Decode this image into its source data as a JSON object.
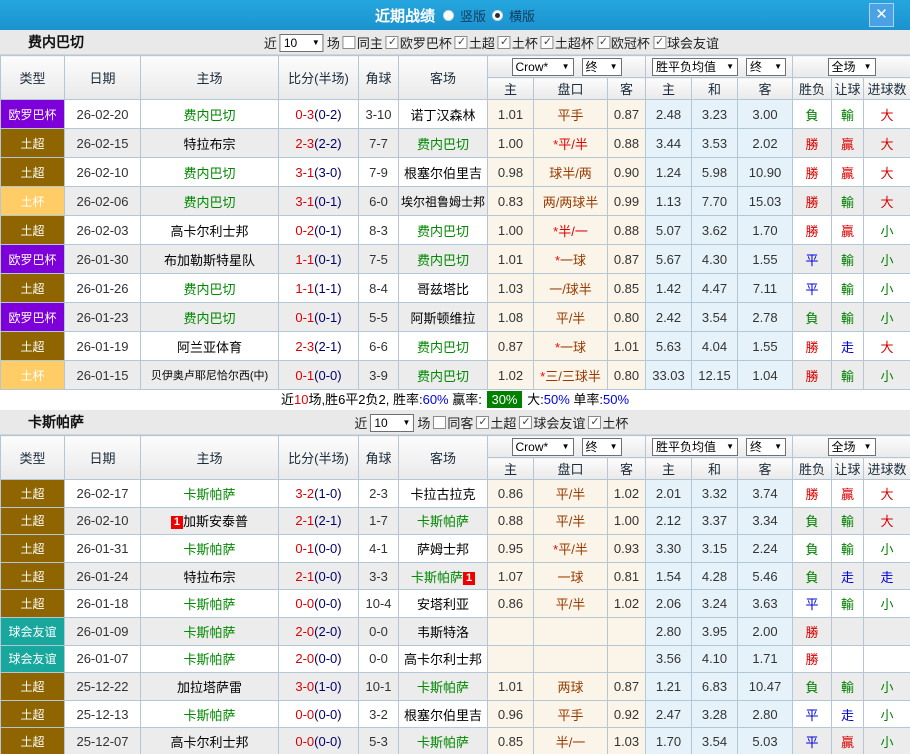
{
  "titlebar": {
    "title": "近期战绩",
    "layout_options": [
      {
        "label": "竖版",
        "selected": false
      },
      {
        "label": "横版",
        "selected": true
      }
    ],
    "close_label": "✕"
  },
  "table_header": {
    "cols": [
      "类型",
      "日期",
      "主场",
      "比分(半场)",
      "角球",
      "客场"
    ],
    "odds_group": {
      "select1": "Crow*",
      "select2": "终",
      "subcols": [
        "主",
        "盘口",
        "客"
      ]
    },
    "avg_group": {
      "select1": "胜平负均值",
      "select2": "终",
      "subcols": [
        "主",
        "和",
        "客"
      ]
    },
    "result_group": {
      "select1": "全场",
      "subcols": [
        "胜负",
        "让球",
        "进球数"
      ]
    }
  },
  "colors": {
    "type_badges": {
      "欧罗巴杯": "#7d00da",
      "土超": "#8e6500",
      "土杯": "#ffcc66",
      "欧冠杯": "#8e6500",
      "球会友谊": "#17a79d"
    },
    "outcome": {
      "勝": "#dd0000",
      "贏": "#dd0000",
      "大": "#dd0000",
      "負": "#008000",
      "輸": "#008000",
      "小": "#008000",
      "平": "#0000dd",
      "走": "#0000dd"
    }
  },
  "sections": [
    {
      "team": "费内巴切",
      "filter": {
        "near": "近",
        "count": "10",
        "unit": "场",
        "same": {
          "label": "同主",
          "checked": false
        },
        "leagues": [
          {
            "label": "欧罗巴杯",
            "checked": true
          },
          {
            "label": "土超",
            "checked": true
          },
          {
            "label": "土杯",
            "checked": true
          },
          {
            "label": "土超杯",
            "checked": true
          },
          {
            "label": "欧冠杯",
            "checked": true
          },
          {
            "label": "球会友谊",
            "checked": true
          }
        ]
      },
      "rows": [
        {
          "t": "欧罗巴杯",
          "d": "26-02-20",
          "h": "费内巴切",
          "hg": true,
          "hc": false,
          "s": "0-3",
          "sh": "(0-2)",
          "cn": "3-10",
          "a": "诺丁汉森林",
          "ag": false,
          "ac": false,
          "o1": "1.01",
          "pks": false,
          "pk": "平手",
          "pkr": false,
          "o2": "0.87",
          "v1": "2.48",
          "v2": "3.23",
          "v3": "3.00",
          "r1": "負",
          "r2": "輸",
          "r3": "大"
        },
        {
          "t": "土超",
          "d": "26-02-15",
          "h": "特拉布宗",
          "hg": false,
          "hc": false,
          "s": "2-3",
          "sh": "(2-2)",
          "cn": "7-7",
          "a": "费内巴切",
          "ag": true,
          "ac": false,
          "o1": "1.00",
          "pks": true,
          "pk": "平/半",
          "pkr": true,
          "o2": "0.88",
          "v1": "3.44",
          "v2": "3.53",
          "v3": "2.02",
          "r1": "勝",
          "r2": "贏",
          "r3": "大"
        },
        {
          "t": "土超",
          "d": "26-02-10",
          "h": "费内巴切",
          "hg": true,
          "hc": false,
          "s": "3-1",
          "sh": "(3-0)",
          "cn": "7-9",
          "a": "根塞尔伯里吉",
          "ag": false,
          "ac": false,
          "o1": "0.98",
          "pks": false,
          "pk": "球半/两",
          "pkr": false,
          "o2": "0.90",
          "v1": "1.24",
          "v2": "5.98",
          "v3": "10.90",
          "r1": "勝",
          "r2": "贏",
          "r3": "大"
        },
        {
          "t": "土杯",
          "d": "26-02-06",
          "h": "费内巴切",
          "hg": true,
          "hc": false,
          "s": "3-1",
          "sh": "(0-1)",
          "cn": "6-0",
          "a": "埃尔祖鲁姆士邦",
          "ag": false,
          "ac": false,
          "o1": "0.83",
          "pks": false,
          "pk": "两/两球半",
          "pkr": false,
          "o2": "0.99",
          "v1": "1.13",
          "v2": "7.70",
          "v3": "15.03",
          "r1": "勝",
          "r2": "輸",
          "r3": "大"
        },
        {
          "t": "土超",
          "d": "26-02-03",
          "h": "高卡尔利士邦",
          "hg": false,
          "hc": false,
          "s": "0-2",
          "sh": "(0-1)",
          "cn": "8-3",
          "a": "费内巴切",
          "ag": true,
          "ac": false,
          "o1": "1.00",
          "pks": true,
          "pk": "半/一",
          "pkr": true,
          "o2": "0.88",
          "v1": "5.07",
          "v2": "3.62",
          "v3": "1.70",
          "r1": "勝",
          "r2": "贏",
          "r3": "小"
        },
        {
          "t": "欧罗巴杯",
          "d": "26-01-30",
          "h": "布加勒斯特星队",
          "hg": false,
          "hc": false,
          "s": "1-1",
          "sh": "(0-1)",
          "cn": "7-5",
          "a": "费内巴切",
          "ag": true,
          "ac": false,
          "o1": "1.01",
          "pks": true,
          "pk": "一球",
          "pkr": false,
          "o2": "0.87",
          "v1": "5.67",
          "v2": "4.30",
          "v3": "1.55",
          "r1": "平",
          "r2": "輸",
          "r3": "小"
        },
        {
          "t": "土超",
          "d": "26-01-26",
          "h": "费内巴切",
          "hg": true,
          "hc": false,
          "s": "1-1",
          "sh": "(1-1)",
          "cn": "8-4",
          "a": "哥兹塔比",
          "ag": false,
          "ac": false,
          "o1": "1.03",
          "pks": false,
          "pk": "一/球半",
          "pkr": false,
          "o2": "0.85",
          "v1": "1.42",
          "v2": "4.47",
          "v3": "7.11",
          "r1": "平",
          "r2": "輸",
          "r3": "小"
        },
        {
          "t": "欧罗巴杯",
          "d": "26-01-23",
          "h": "费内巴切",
          "hg": true,
          "hc": false,
          "s": "0-1",
          "sh": "(0-1)",
          "cn": "5-5",
          "a": "阿斯顿维拉",
          "ag": false,
          "ac": false,
          "o1": "1.08",
          "pks": false,
          "pk": "平/半",
          "pkr": false,
          "o2": "0.80",
          "v1": "2.42",
          "v2": "3.54",
          "v3": "2.78",
          "r1": "負",
          "r2": "輸",
          "r3": "小"
        },
        {
          "t": "土超",
          "d": "26-01-19",
          "h": "阿兰亚体育",
          "hg": false,
          "hc": false,
          "s": "2-3",
          "sh": "(2-1)",
          "cn": "6-6",
          "a": "费内巴切",
          "ag": true,
          "ac": false,
          "o1": "0.87",
          "pks": true,
          "pk": "一球",
          "pkr": false,
          "o2": "1.01",
          "v1": "5.63",
          "v2": "4.04",
          "v3": "1.55",
          "r1": "勝",
          "r2": "走",
          "r3": "大"
        },
        {
          "t": "土杯",
          "d": "26-01-15",
          "h": "贝伊奥卢耶尼恰尔西(中)",
          "hg": false,
          "hc": false,
          "s": "0-1",
          "sh": "(0-0)",
          "cn": "3-9",
          "a": "费内巴切",
          "ag": true,
          "ac": false,
          "o1": "1.02",
          "pks": true,
          "pk": "三/三球半",
          "pkr": false,
          "o2": "0.80",
          "v1": "33.03",
          "v2": "12.15",
          "v3": "1.04",
          "r1": "勝",
          "r2": "輸",
          "r3": "小"
        }
      ],
      "summary": [
        {
          "t": "近",
          "c": "k"
        },
        {
          "t": "10",
          "c": "r"
        },
        {
          "t": "场,胜6平2负2, 胜率:",
          "c": "k"
        },
        {
          "t": "60%",
          "c": "b"
        },
        {
          "t": " 赢率: ",
          "c": "k"
        },
        {
          "t": "30%",
          "c": "g"
        },
        {
          "t": " 大:",
          "c": "k"
        },
        {
          "t": "50%",
          "c": "b"
        },
        {
          "t": " 单率:",
          "c": "k"
        },
        {
          "t": "50%",
          "c": "b"
        }
      ]
    },
    {
      "team": "卡斯帕萨",
      "filter": {
        "near": "近",
        "count": "10",
        "unit": "场",
        "same": {
          "label": "同客",
          "checked": false
        },
        "leagues": [
          {
            "label": "土超",
            "checked": true
          },
          {
            "label": "球会友谊",
            "checked": true
          },
          {
            "label": "土杯",
            "checked": true
          }
        ]
      },
      "rows": [
        {
          "t": "土超",
          "d": "26-02-17",
          "h": "卡斯帕萨",
          "hg": true,
          "hc": false,
          "s": "3-2",
          "sh": "(1-0)",
          "cn": "2-3",
          "a": "卡拉古拉克",
          "ag": false,
          "ac": false,
          "o1": "0.86",
          "pks": false,
          "pk": "平/半",
          "pkr": false,
          "o2": "1.02",
          "v1": "2.01",
          "v2": "3.32",
          "v3": "3.74",
          "r1": "勝",
          "r2": "贏",
          "r3": "大"
        },
        {
          "t": "土超",
          "d": "26-02-10",
          "h": "加斯安泰普",
          "hg": false,
          "hc": true,
          "s": "2-1",
          "sh": "(2-1)",
          "cn": "1-7",
          "a": "卡斯帕萨",
          "ag": true,
          "ac": false,
          "o1": "0.88",
          "pks": false,
          "pk": "平/半",
          "pkr": false,
          "o2": "1.00",
          "v1": "2.12",
          "v2": "3.37",
          "v3": "3.34",
          "r1": "負",
          "r2": "輸",
          "r3": "大"
        },
        {
          "t": "土超",
          "d": "26-01-31",
          "h": "卡斯帕萨",
          "hg": true,
          "hc": false,
          "s": "0-1",
          "sh": "(0-0)",
          "cn": "4-1",
          "a": "萨姆士邦",
          "ag": false,
          "ac": false,
          "o1": "0.95",
          "pks": true,
          "pk": "平/半",
          "pkr": false,
          "o2": "0.93",
          "v1": "3.30",
          "v2": "3.15",
          "v3": "2.24",
          "r1": "負",
          "r2": "輸",
          "r3": "小"
        },
        {
          "t": "土超",
          "d": "26-01-24",
          "h": "特拉布宗",
          "hg": false,
          "hc": false,
          "s": "2-1",
          "sh": "(0-0)",
          "cn": "3-3",
          "a": "卡斯帕萨",
          "ag": true,
          "ac": true,
          "o1": "1.07",
          "pks": false,
          "pk": "一球",
          "pkr": false,
          "o2": "0.81",
          "v1": "1.54",
          "v2": "4.28",
          "v3": "5.46",
          "r1": "負",
          "r2": "走",
          "r3": "走"
        },
        {
          "t": "土超",
          "d": "26-01-18",
          "h": "卡斯帕萨",
          "hg": true,
          "hc": false,
          "s": "0-0",
          "sh": "(0-0)",
          "cn": "10-4",
          "a": "安塔利亚",
          "ag": false,
          "ac": false,
          "o1": "0.86",
          "pks": false,
          "pk": "平/半",
          "pkr": false,
          "o2": "1.02",
          "v1": "2.06",
          "v2": "3.24",
          "v3": "3.63",
          "r1": "平",
          "r2": "輸",
          "r3": "小"
        },
        {
          "t": "球会友谊",
          "d": "26-01-09",
          "h": "卡斯帕萨",
          "hg": true,
          "hc": false,
          "s": "2-0",
          "sh": "(2-0)",
          "cn": "0-0",
          "a": "韦斯特洛",
          "ag": false,
          "ac": false,
          "o1": "",
          "pks": false,
          "pk": "",
          "pkr": false,
          "o2": "",
          "v1": "2.80",
          "v2": "3.95",
          "v3": "2.00",
          "r1": "勝",
          "r2": "",
          "r3": ""
        },
        {
          "t": "球会友谊",
          "d": "26-01-07",
          "h": "卡斯帕萨",
          "hg": true,
          "hc": false,
          "s": "2-0",
          "sh": "(0-0)",
          "cn": "0-0",
          "a": "高卡尔利士邦",
          "ag": false,
          "ac": false,
          "o1": "",
          "pks": false,
          "pk": "",
          "pkr": false,
          "o2": "",
          "v1": "3.56",
          "v2": "4.10",
          "v3": "1.71",
          "r1": "勝",
          "r2": "",
          "r3": ""
        },
        {
          "t": "土超",
          "d": "25-12-22",
          "h": "加拉塔萨雷",
          "hg": false,
          "hc": false,
          "s": "3-0",
          "sh": "(1-0)",
          "cn": "10-1",
          "a": "卡斯帕萨",
          "ag": true,
          "ac": false,
          "o1": "1.01",
          "pks": false,
          "pk": "两球",
          "pkr": false,
          "o2": "0.87",
          "v1": "1.21",
          "v2": "6.83",
          "v3": "10.47",
          "r1": "負",
          "r2": "輸",
          "r3": "小"
        },
        {
          "t": "土超",
          "d": "25-12-13",
          "h": "卡斯帕萨",
          "hg": true,
          "hc": false,
          "s": "0-0",
          "sh": "(0-0)",
          "cn": "3-2",
          "a": "根塞尔伯里吉",
          "ag": false,
          "ac": false,
          "o1": "0.96",
          "pks": false,
          "pk": "平手",
          "pkr": false,
          "o2": "0.92",
          "v1": "2.47",
          "v2": "3.28",
          "v3": "2.80",
          "r1": "平",
          "r2": "走",
          "r3": "小"
        },
        {
          "t": "土超",
          "d": "25-12-07",
          "h": "高卡尔利士邦",
          "hg": false,
          "hc": false,
          "s": "0-0",
          "sh": "(0-0)",
          "cn": "5-3",
          "a": "卡斯帕萨",
          "ag": true,
          "ac": false,
          "o1": "0.85",
          "pks": false,
          "pk": "半/一",
          "pkr": false,
          "o2": "1.03",
          "v1": "1.70",
          "v2": "3.54",
          "v3": "5.03",
          "r1": "平",
          "r2": "贏",
          "r3": "小"
        }
      ],
      "summary": null
    }
  ]
}
